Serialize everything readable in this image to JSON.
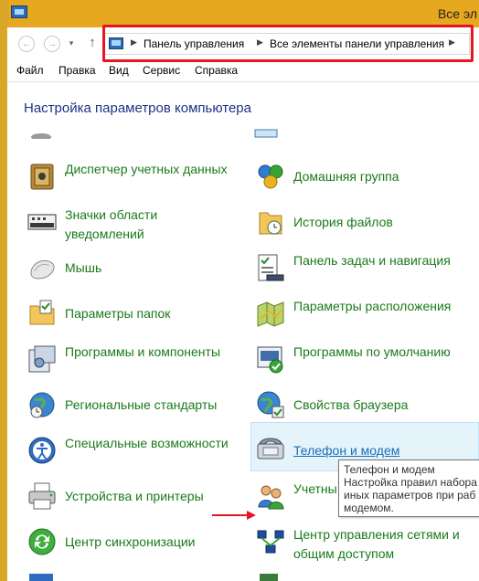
{
  "window": {
    "title": "Все эл"
  },
  "address": {
    "crumbs": [
      "Панель управления",
      "Все элементы панели управления"
    ]
  },
  "menu": [
    "Файл",
    "Правка",
    "Вид",
    "Сервис",
    "Справка"
  ],
  "heading": "Настройка параметров компьютера",
  "items_left": [
    {
      "label": "Диспетчер учетных данных",
      "icon": "credential-vault-icon"
    },
    {
      "label": "Значки области уведомлений",
      "icon": "notification-icons-icon"
    },
    {
      "label": "Мышь",
      "icon": "mouse-icon"
    },
    {
      "label": "Параметры папок",
      "icon": "folder-options-icon"
    },
    {
      "label": "Программы и компоненты",
      "icon": "programs-icon"
    },
    {
      "label": "Региональные стандарты",
      "icon": "globe-clock-icon"
    },
    {
      "label": "Специальные возможности",
      "icon": "accessibility-icon"
    },
    {
      "label": "Устройства и принтеры",
      "icon": "printer-icon"
    },
    {
      "label": "Центр синхронизации",
      "icon": "sync-icon"
    }
  ],
  "items_right": [
    {
      "label": "Домашняя группа",
      "icon": "homegroup-icon"
    },
    {
      "label": "История файлов",
      "icon": "file-history-icon"
    },
    {
      "label": "Панель задач и навигация",
      "icon": "taskbar-icon"
    },
    {
      "label": "Параметры расположения",
      "icon": "location-icon"
    },
    {
      "label": "Программы по умолчанию",
      "icon": "default-programs-icon"
    },
    {
      "label": "Свойства браузера",
      "icon": "browser-icon"
    },
    {
      "label": "Телефон и модем",
      "icon": "phone-modem-icon"
    },
    {
      "label": "Учетны пользов",
      "icon": "user-accounts-icon"
    },
    {
      "label": "Центр управления сетями и общим доступом",
      "icon": "network-center-icon"
    }
  ],
  "tooltip": {
    "title": "Телефон и модем",
    "line1": "Настройка правил набора",
    "line2": "иных параметров при раб",
    "line3": "модемом."
  }
}
